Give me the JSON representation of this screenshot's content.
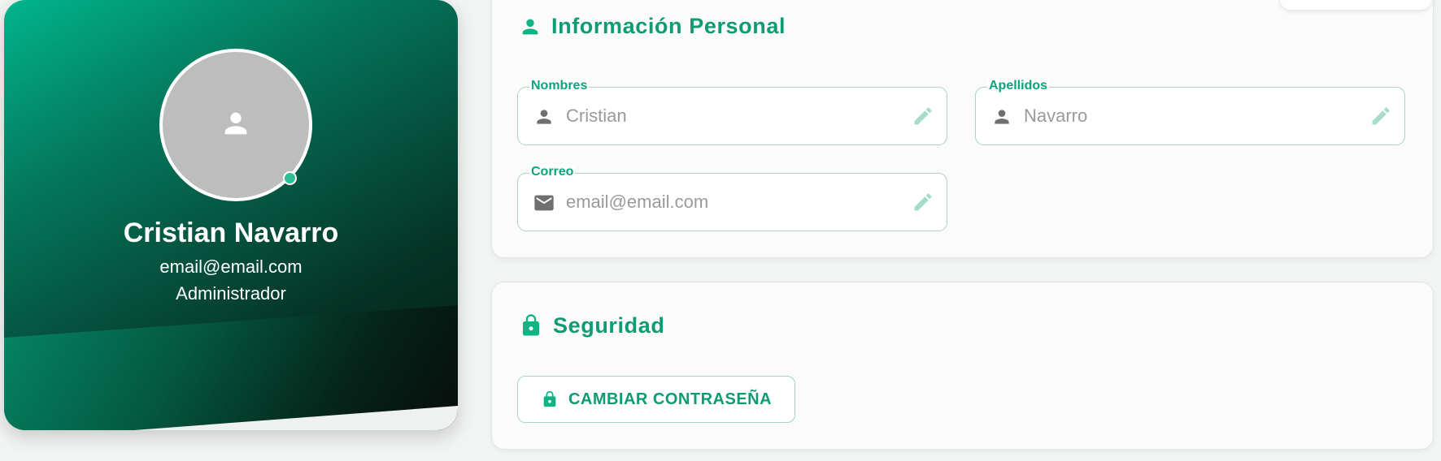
{
  "profile": {
    "name": "Cristian Navarro",
    "email": "email@email.com",
    "role": "Administrador",
    "avatar_icon": "person-icon",
    "status_color": "#2fbf95"
  },
  "personal_info": {
    "title": "Información Personal",
    "title_icon": "person-icon",
    "fields": {
      "nombres": {
        "label": "Nombres",
        "placeholder": "Cristian",
        "value": "",
        "icon": "person-icon",
        "action_icon": "edit-pencil-icon"
      },
      "apellidos": {
        "label": "Apellidos",
        "placeholder": "Navarro",
        "value": "",
        "icon": "person-icon",
        "action_icon": "edit-pencil-icon"
      },
      "correo": {
        "label": "Correo",
        "placeholder": "email@email.com",
        "value": "",
        "icon": "mail-icon",
        "action_icon": "edit-pencil-icon"
      }
    }
  },
  "security": {
    "title": "Seguridad",
    "title_icon": "lock-icon",
    "change_password_label": "CAMBIAR CONTRASEÑA",
    "change_password_icon": "lock-icon"
  },
  "colors": {
    "accent": "#0f9b73",
    "accent_light": "#a9d3c5",
    "card_gradient_start": "#01b58c",
    "card_gradient_end": "#061a14"
  }
}
